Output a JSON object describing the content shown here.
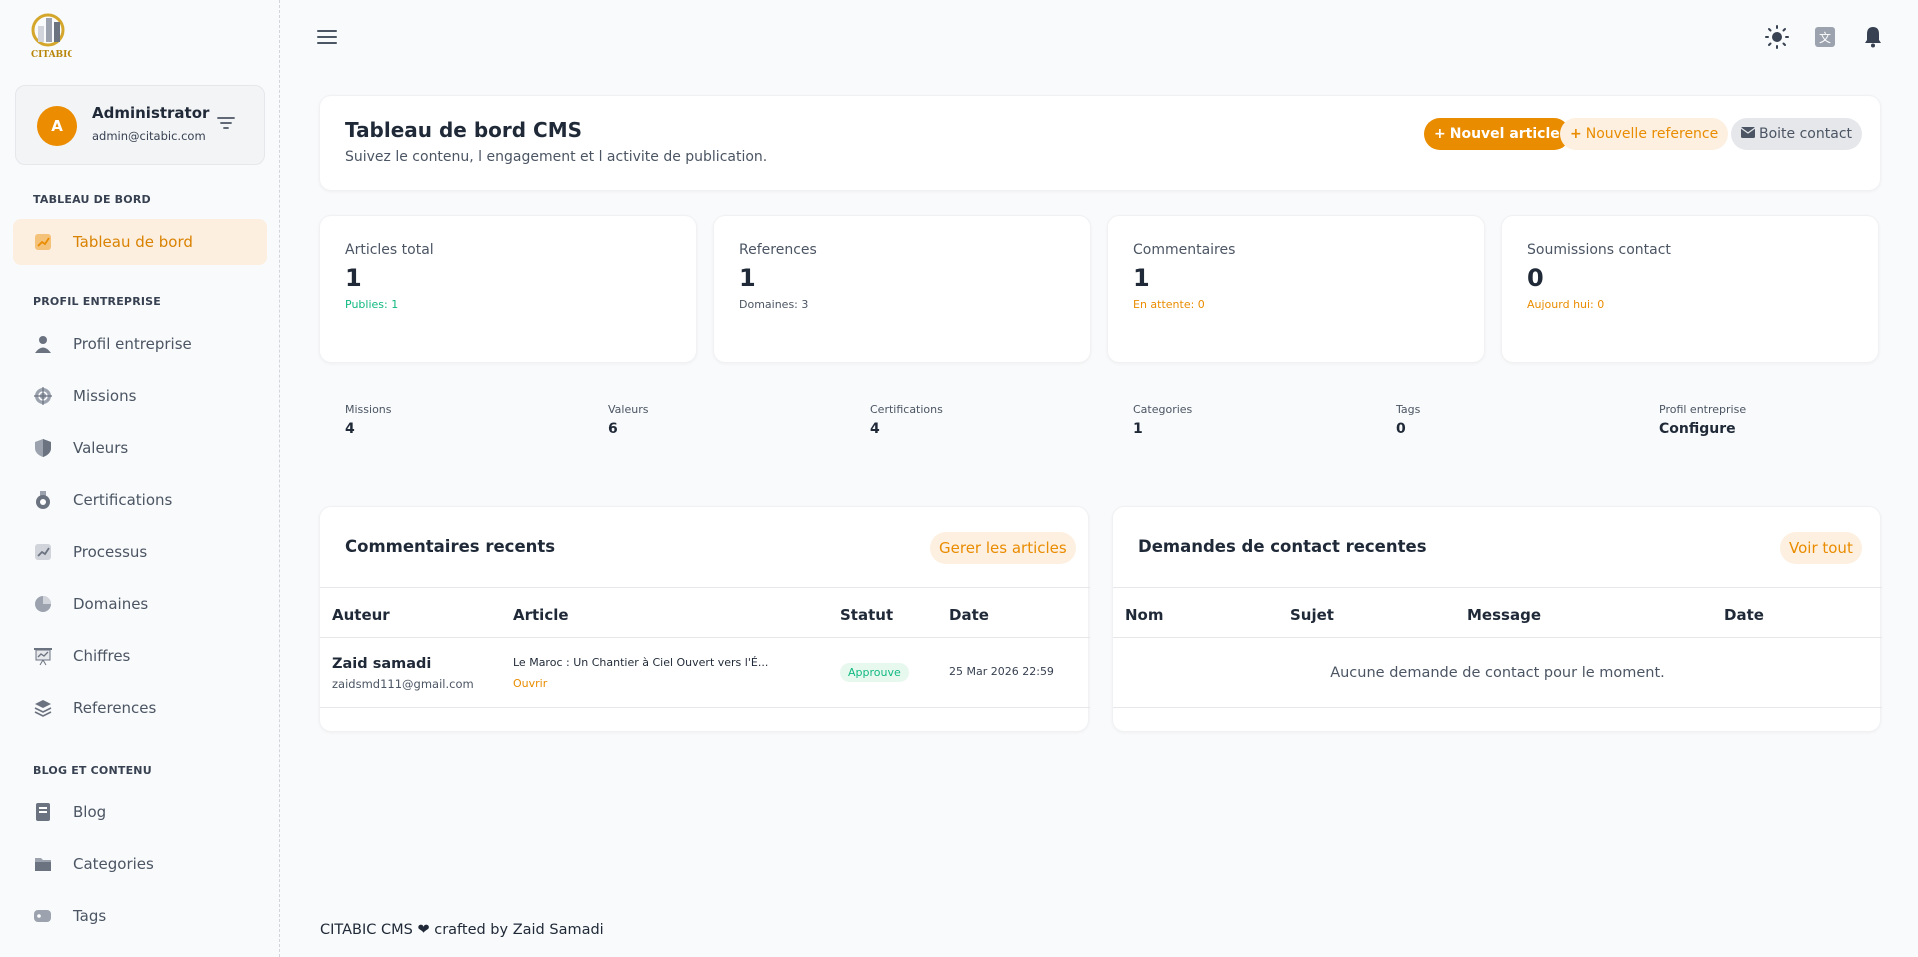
{
  "brand": {
    "name": "CITABIC",
    "accent": "#e98c00"
  },
  "user": {
    "initial": "A",
    "name": "Administrator",
    "email": "admin@citabic.com"
  },
  "sidebar": {
    "sections": [
      {
        "title": "TABLEAU DE BORD",
        "items": [
          {
            "label": "Tableau de bord",
            "icon": "chart-icon",
            "active": true
          }
        ]
      },
      {
        "title": "PROFIL ENTREPRISE",
        "items": [
          {
            "label": "Profil entreprise",
            "icon": "user-icon"
          },
          {
            "label": "Missions",
            "icon": "target-icon"
          },
          {
            "label": "Valeurs",
            "icon": "shield-icon"
          },
          {
            "label": "Certifications",
            "icon": "medal-icon"
          },
          {
            "label": "Processus",
            "icon": "chart-icon"
          },
          {
            "label": "Domaines",
            "icon": "pie-icon"
          },
          {
            "label": "Chiffres",
            "icon": "presentation-icon"
          },
          {
            "label": "References",
            "icon": "layers-icon"
          }
        ]
      },
      {
        "title": "BLOG ET CONTENU",
        "items": [
          {
            "label": "Blog",
            "icon": "document-icon"
          },
          {
            "label": "Categories",
            "icon": "folder-icon"
          },
          {
            "label": "Tags",
            "icon": "tag-icon"
          }
        ]
      }
    ]
  },
  "header": {
    "title": "Tableau de bord CMS",
    "subtitle": "Suivez le contenu, l engagement et l activite de publication.",
    "buttons": {
      "new_article": "Nouvel article",
      "new_reference": "Nouvelle reference",
      "contact_box": "Boite contact"
    }
  },
  "stats": [
    {
      "label": "Articles total",
      "value": "1",
      "sub": "Publies: 1",
      "sub_color": "#10b981"
    },
    {
      "label": "References",
      "value": "1",
      "sub": "Domaines: 3",
      "sub_color": "#4b5563"
    },
    {
      "label": "Commentaires",
      "value": "1",
      "sub": "En attente: 0",
      "sub_color": "#e98c00"
    },
    {
      "label": "Soumissions contact",
      "value": "0",
      "sub": "Aujourd hui: 0",
      "sub_color": "#e98c00"
    }
  ],
  "mini_stats": [
    {
      "label": "Missions",
      "value": "4"
    },
    {
      "label": "Valeurs",
      "value": "6"
    },
    {
      "label": "Certifications",
      "value": "4"
    },
    {
      "label": "Categories",
      "value": "1"
    },
    {
      "label": "Tags",
      "value": "0"
    },
    {
      "label": "Profil entreprise",
      "value": "Configure"
    }
  ],
  "comments": {
    "title": "Commentaires recents",
    "link": "Gerer les articles",
    "columns": [
      "Auteur",
      "Article",
      "Statut",
      "Date"
    ],
    "rows": [
      {
        "author": "Zaid samadi",
        "email": "zaidsmd111@gmail.com",
        "article": "Le Maroc : Un Chantier à Ciel Ouvert vers l'É...",
        "open": "Ouvrir",
        "status": "Approuve",
        "date": "25 Mar 2026 22:59"
      }
    ]
  },
  "contacts": {
    "title": "Demandes de contact recentes",
    "link": "Voir tout",
    "columns": [
      "Nom",
      "Sujet",
      "Message",
      "Date"
    ],
    "empty": "Aucune demande de contact pour le moment."
  },
  "footer": {
    "text": "CITABIC CMS ❤ crafted by Zaid Samadi"
  }
}
